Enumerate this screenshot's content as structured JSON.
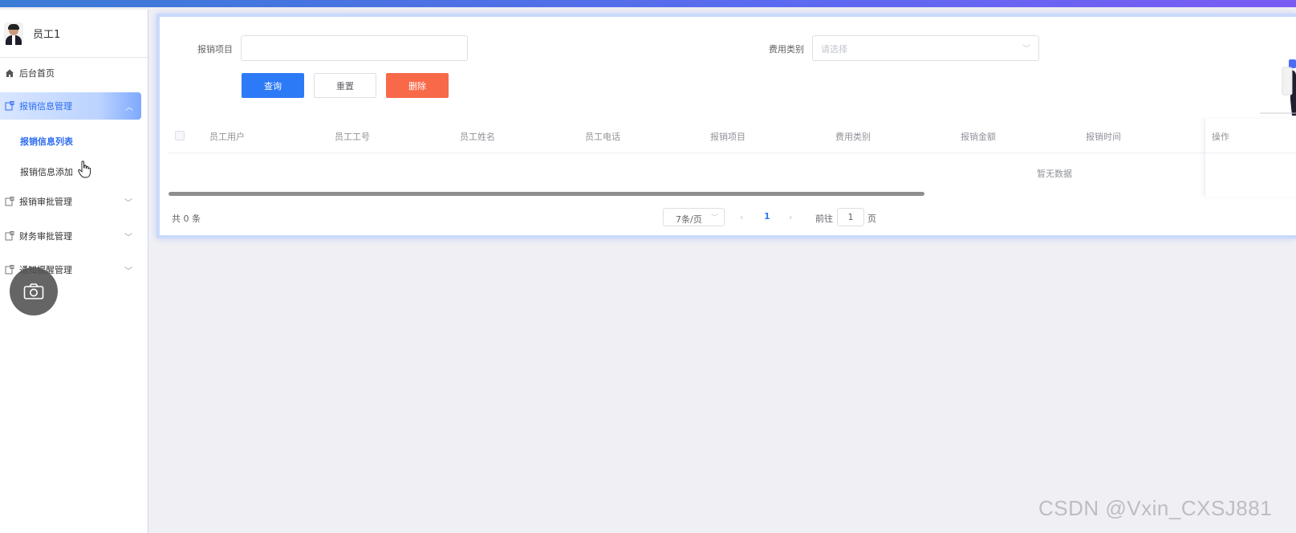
{
  "user": {
    "name": "员工1"
  },
  "sidebar": {
    "items": [
      {
        "label": "后台首页"
      },
      {
        "label": "报销信息管理",
        "expanded": true
      },
      {
        "label": "报销审批管理"
      },
      {
        "label": "财务审批管理"
      },
      {
        "label": "通知提醒管理"
      }
    ],
    "submenu": [
      {
        "label": "报销信息列表",
        "active": true
      },
      {
        "label": "报销信息添加"
      }
    ]
  },
  "search": {
    "item_label": "报销项目",
    "item_value": "",
    "category_label": "费用类别",
    "category_placeholder": "请选择"
  },
  "buttons": {
    "query": "查询",
    "reset": "重置",
    "delete": "删除"
  },
  "table": {
    "columns": [
      "员工用户",
      "员工工号",
      "员工姓名",
      "员工电话",
      "报销项目",
      "费用类别",
      "报销金额",
      "报销时间",
      "操作"
    ],
    "empty_text": "暂无数据"
  },
  "pagination": {
    "total_text": "共 0 条",
    "page_size": "7条/页",
    "current_page": "1",
    "goto_label": "前往",
    "goto_value": "1",
    "page_unit": "页"
  },
  "watermark": "CSDN @Vxin_CXSJ881",
  "colors": {
    "primary": "#2d7af7",
    "danger": "#f76949",
    "accent": "#2d6cf0"
  }
}
